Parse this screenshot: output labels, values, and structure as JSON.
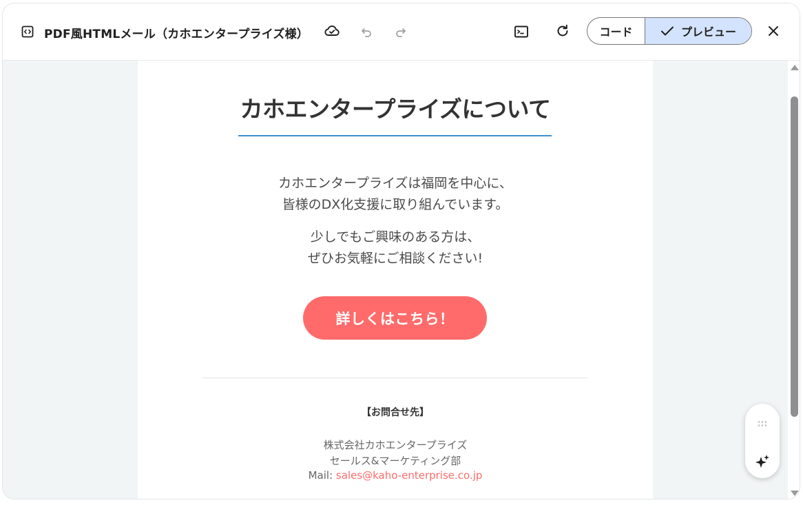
{
  "toolbar": {
    "title": "PDF風HTMLメール（カホエンタープライズ様）",
    "code_label": "コード",
    "preview_label": "プレビュー"
  },
  "email": {
    "heading": "カホエンタープライズについて",
    "para1_line1": "カホエンタープライズは福岡を中心に、",
    "para1_line2": "皆様のDX化支援に取り組んでいます。",
    "para2_line1": "少しでもご興味のある方は、",
    "para2_line2": "ぜひお気軽にご相談ください!",
    "cta_label": "詳しくはこちら！",
    "contact_title": "【お問合せ先】",
    "company": "株式会社カホエンタープライズ",
    "department": "セールス&マーケティング部",
    "mail_prefix": "Mail: ",
    "mail_address": "sales@kaho-enterprise.co.jp"
  },
  "colors": {
    "accent_blue": "#3d8fd1",
    "cta": "#ff6b6b",
    "preview_selected": "#d3e3fd"
  }
}
